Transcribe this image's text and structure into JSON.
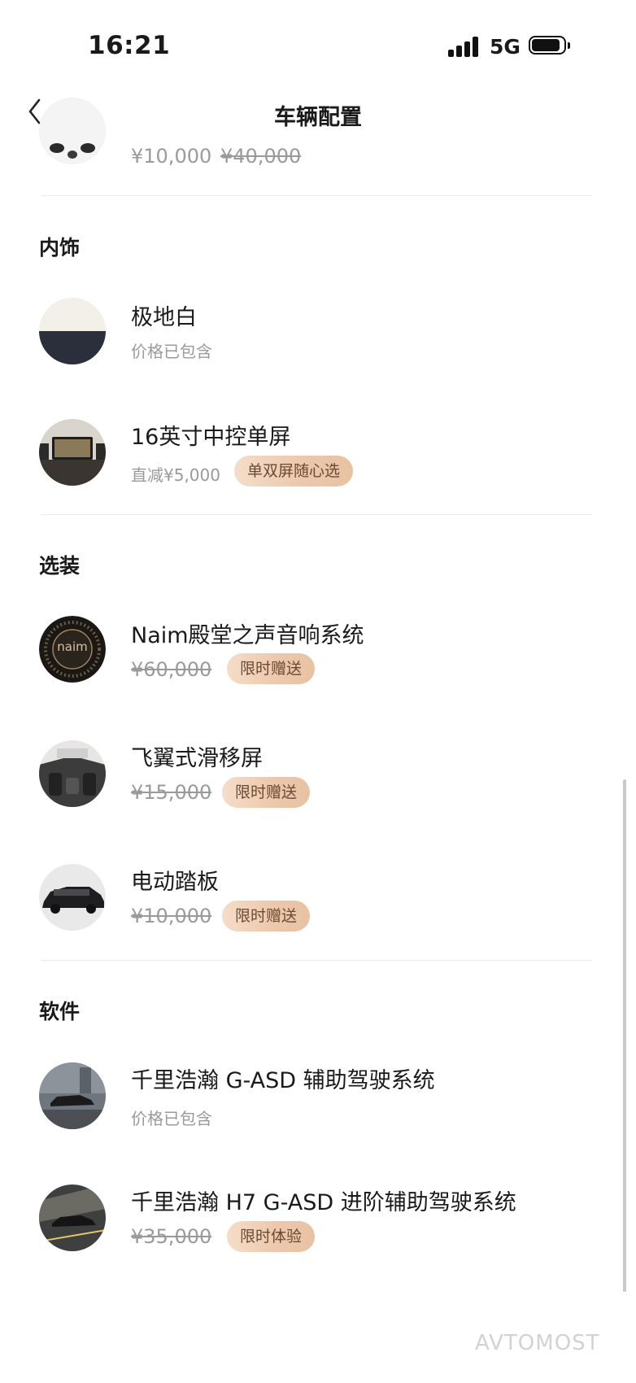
{
  "status_bar": {
    "time": "16:21",
    "network": "5G"
  },
  "nav": {
    "title": "车辆配置"
  },
  "top_item": {
    "price": "¥10,000",
    "original_price": "¥40,000"
  },
  "sections": {
    "interior": {
      "title": "内饰",
      "items": [
        {
          "name": "极地白",
          "sub": "价格已包含"
        },
        {
          "name": "16英寸中控单屏",
          "sub": "直减¥5,000",
          "tag": "单双屏随心选"
        }
      ]
    },
    "options": {
      "title": "选装",
      "items": [
        {
          "name": "Naim殿堂之声音响系统",
          "original_price": "¥60,000",
          "tag": "限时赠送",
          "logo_text": "naim"
        },
        {
          "name": "飞翼式滑移屏",
          "original_price": "¥15,000",
          "tag": "限时赠送"
        },
        {
          "name": "电动踏板",
          "original_price": "¥10,000",
          "tag": "限时赠送"
        }
      ]
    },
    "software": {
      "title": "软件",
      "items": [
        {
          "name": "千里浩瀚 G-ASD 辅助驾驶系统",
          "sub": "价格已包含"
        },
        {
          "name": "千里浩瀚 H7 G-ASD 进阶辅助驾驶系统",
          "original_price": "¥35,000",
          "tag": "限时体验"
        }
      ]
    }
  },
  "watermark": "AVTOMOST",
  "colors": {
    "tag_bg": "#efcfb6",
    "tag_text": "#6b4a33",
    "muted": "#9a9a9a"
  }
}
